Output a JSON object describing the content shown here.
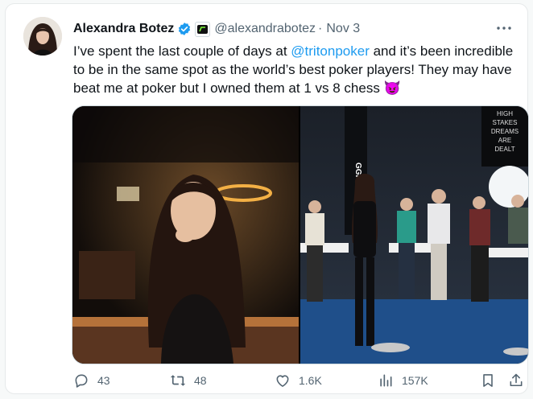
{
  "tweet": {
    "author_name": "Alexandra Botez",
    "handle": "@alexandrabotez",
    "separator": "·",
    "date": "Nov 3",
    "text_before": "I’ve spent the last couple of days at ",
    "mention": "@tritonpoker",
    "text_after": " and it’s been incredible to be in the same spot as the world’s best poker players! They may have beat me at poker but I owned them at 1 vs 8 chess 😈",
    "icons": {
      "verified": "verified-badge-icon",
      "affiliate": "affiliate-logo-icon",
      "more": "more-options-icon"
    }
  },
  "media": {
    "left_image": "photo-woman-posing-at-poker-table",
    "right_image": "photo-chess-exhibition-on-poker-stage",
    "right_banner_text": [
      "HIGH",
      "STAKES",
      "DREAMS",
      "ARE",
      "DEALT"
    ],
    "right_sign_text": "GGPOKER"
  },
  "actions": {
    "replies": "43",
    "reposts": "48",
    "likes": "1.6K",
    "views": "157K"
  },
  "colors": {
    "accent": "#1d9bf0",
    "text": "#0f1419",
    "muted": "#536471"
  }
}
